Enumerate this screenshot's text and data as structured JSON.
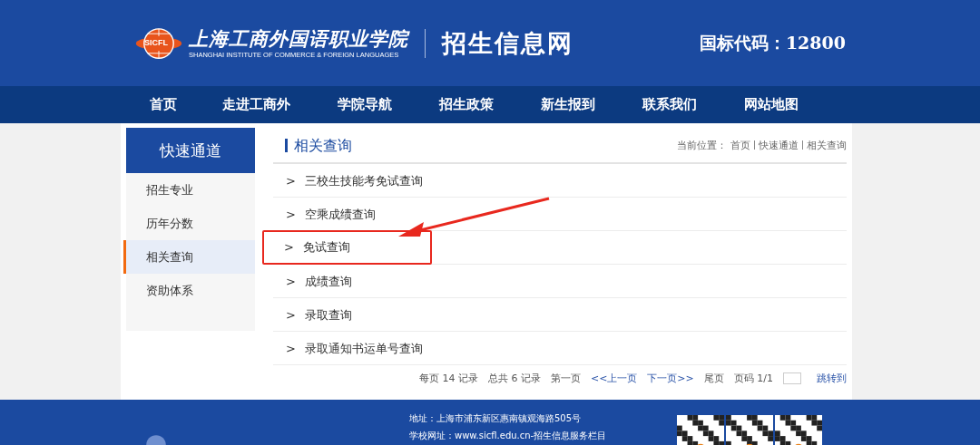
{
  "header": {
    "logo_badge": "SICFL",
    "school_name": "上海工商外国语职业学院",
    "school_name_en": "SHANGHAI INSTITUTE OF COMMERCE & FOREIGN LANGUAGES",
    "site_title": "招生信息网",
    "code": "国标代码：12800"
  },
  "nav": [
    "首页",
    "走进工商外",
    "学院导航",
    "招生政策",
    "新生报到",
    "联系我们",
    "网站地图"
  ],
  "sidebar": {
    "title": "快速通道",
    "items": [
      {
        "label": "招生专业",
        "selected": false
      },
      {
        "label": "历年分数",
        "selected": false
      },
      {
        "label": "相关查询",
        "selected": true
      },
      {
        "label": "资助体系",
        "selected": false
      }
    ]
  },
  "main": {
    "title": "相关查询",
    "breadcrumb": {
      "prefix": "当前位置：",
      "items": [
        "首页",
        "快速通道",
        "相关查询"
      ]
    },
    "items": [
      {
        "marker": ">",
        "label": "三校生技能考免试查询",
        "highlighted": false
      },
      {
        "marker": ">",
        "label": "空乘成绩查询",
        "highlighted": false
      },
      {
        "marker": ">",
        "label": "免试查询",
        "highlighted": true
      },
      {
        "marker": ">",
        "label": "成绩查询",
        "highlighted": false
      },
      {
        "marker": ">",
        "label": "录取查询",
        "highlighted": false
      },
      {
        "marker": ">",
        "label": "录取通知书运单号查询",
        "highlighted": false
      }
    ],
    "pager": {
      "per_page": "每页 14 记录",
      "total": "总共 6 记录",
      "first": "第一页",
      "prev": "<<上一页",
      "next": "下一页>>",
      "last": "尾页",
      "page": "页码 1/1",
      "go": "跳转到"
    }
  },
  "footer": {
    "address": "地址：上海市浦东新区惠南镇观海路505号",
    "website": "学校网址：www.sicfl.edu.cn-招生信息服务栏目"
  }
}
